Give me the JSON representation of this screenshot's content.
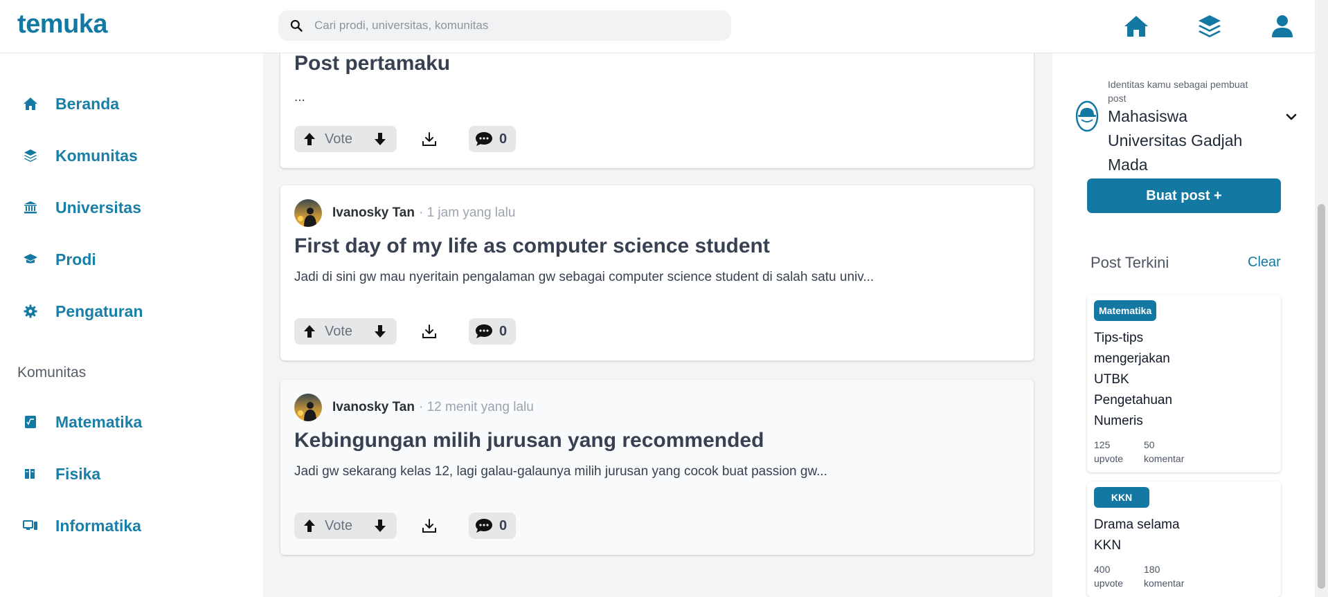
{
  "header": {
    "logo": "temuka",
    "search_placeholder": "Cari prodi, universitas, komunitas"
  },
  "sidebar": {
    "nav": [
      {
        "label": "Beranda",
        "icon": "home-icon"
      },
      {
        "label": "Komunitas",
        "icon": "layers-icon"
      },
      {
        "label": "Universitas",
        "icon": "bank-icon"
      },
      {
        "label": "Prodi",
        "icon": "graduation-cap-icon"
      },
      {
        "label": "Pengaturan",
        "icon": "gear-icon"
      }
    ],
    "communities_title": "Komunitas",
    "communities": [
      {
        "label": "Matematika",
        "icon": "math-icon"
      },
      {
        "label": "Fisika",
        "icon": "book-icon"
      },
      {
        "label": "Informatika",
        "icon": "computer-icon"
      }
    ]
  },
  "feed": {
    "posts": [
      {
        "title": "Post pertamaku",
        "excerpt": "...",
        "vote_label": "Vote",
        "comments": "0"
      },
      {
        "author": "Ivanosky Tan",
        "time": "· 1 jam yang lalu",
        "title": "First day of my life as computer science student",
        "excerpt": "Jadi di sini gw mau nyeritain pengalaman gw sebagai computer science student di salah satu univ...",
        "vote_label": "Vote",
        "comments": "0"
      },
      {
        "author": "Ivanosky Tan",
        "time": "· 12 menit yang lalu",
        "title": "Kebingungan milih jurusan yang recommended",
        "excerpt": "Jadi gw sekarang kelas 12, lagi galau-galaunya milih jurusan yang cocok buat passion gw...",
        "vote_label": "Vote",
        "comments": "0"
      }
    ]
  },
  "rightbar": {
    "identity_label": "Identitas kamu sebagai pembuat post",
    "identity_name": "Mahasiswa Universitas Gadjah Mada",
    "create_button": "Buat post +",
    "recent_title": "Post Terkini",
    "clear_label": "Clear",
    "recent": [
      {
        "tag": "Matematika",
        "title": "Tips-tips mengerjakan UTBK Pengetahuan Numeris",
        "upvotes": "125",
        "upvote_label": "upvote",
        "comments": "50",
        "comment_label": "komentar"
      },
      {
        "tag": "KKN",
        "title": "Drama selama KKN",
        "upvotes": "400",
        "upvote_label": "upvote",
        "comments": "180",
        "comment_label": "komentar"
      }
    ]
  },
  "colors": {
    "accent": "#1479a2",
    "nav_text": "#1a7fa6",
    "feed_bg": "#f3f4f6"
  }
}
